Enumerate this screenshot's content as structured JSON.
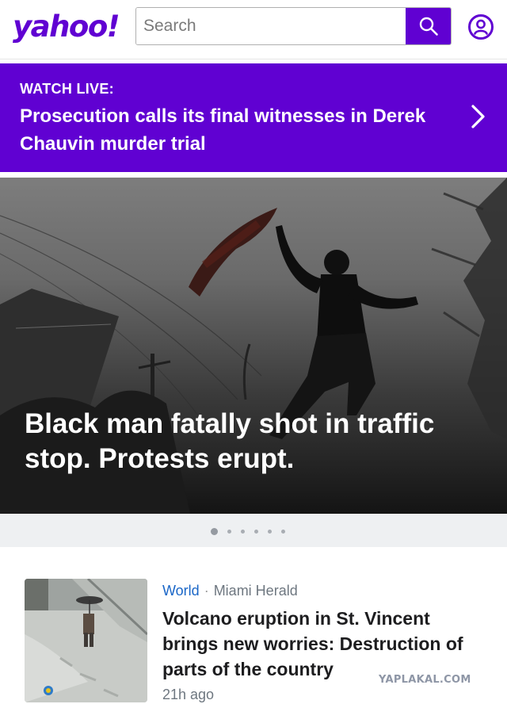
{
  "header": {
    "logo": "yahoo!",
    "search_placeholder": "Search",
    "search_icon": "search-icon",
    "profile_icon": "user-circle-icon",
    "brand_color": "#6001d2"
  },
  "live_banner": {
    "label": "WATCH LIVE:",
    "title": "Prosecution calls its final witnesses in Derek Chauvin murder trial",
    "icon": "chevron-right-icon"
  },
  "hero": {
    "headline": "Black man fatally shot in traffic stop. Protests erupt."
  },
  "carousel": {
    "total": 6,
    "active": 1
  },
  "article": {
    "category": "World",
    "separator": "·",
    "source": "Miami Herald",
    "title": "Volcano eruption in St. Vincent brings new worries: Destruction of parts of the country",
    "time": "21h ago"
  },
  "watermark": "YAPLAKAL.COM"
}
